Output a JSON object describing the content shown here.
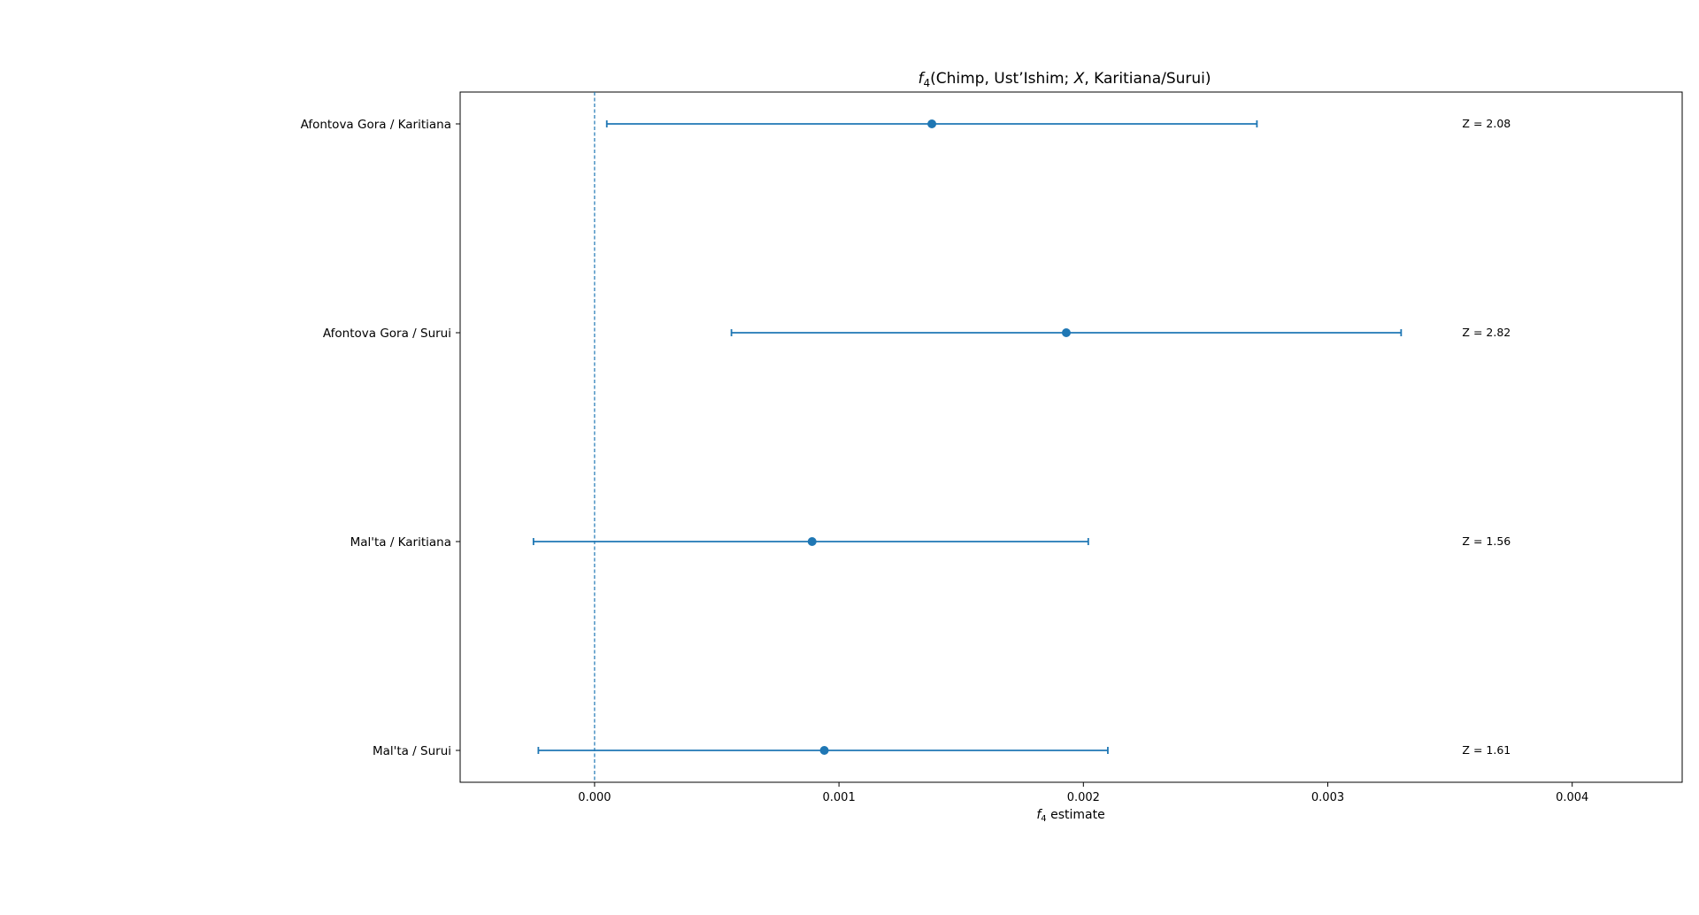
{
  "chart_data": {
    "type": "errorbar",
    "title": {
      "f_symbol": "f",
      "f_subscript": "4",
      "args_before": "(Chimp, Ust’Ishim; ",
      "args_var": "X",
      "args_after": ", Karitiana/Surui)"
    },
    "xlabel": {
      "f_symbol": "f",
      "f_subscript": "4",
      "suffix": " estimate"
    },
    "xlim": [
      -0.00055,
      0.00445
    ],
    "xticks": [
      {
        "value": 0.0,
        "label": "0.000"
      },
      {
        "value": 0.001,
        "label": "0.001"
      },
      {
        "value": 0.002,
        "label": "0.002"
      },
      {
        "value": 0.003,
        "label": "0.003"
      },
      {
        "value": 0.004,
        "label": "0.004"
      }
    ],
    "reference_line_x": 0.0,
    "color": "#1f77b4",
    "rows": [
      {
        "label": "Afontova Gora / Karitiana",
        "estimate": 0.00138,
        "lower": 5e-05,
        "upper": 0.00271,
        "z_text": "Z = 2.08"
      },
      {
        "label": "Afontova Gora / Surui",
        "estimate": 0.00193,
        "lower": 0.00056,
        "upper": 0.0033,
        "z_text": "Z = 2.82"
      },
      {
        "label": "Mal'ta / Karitiana",
        "estimate": 0.00089,
        "lower": -0.00025,
        "upper": 0.00202,
        "z_text": "Z = 1.56"
      },
      {
        "label": "Mal'ta / Surui",
        "estimate": 0.00094,
        "lower": -0.00023,
        "upper": 0.0021,
        "z_text": "Z = 1.61"
      }
    ],
    "z_text_x": 0.00355
  }
}
